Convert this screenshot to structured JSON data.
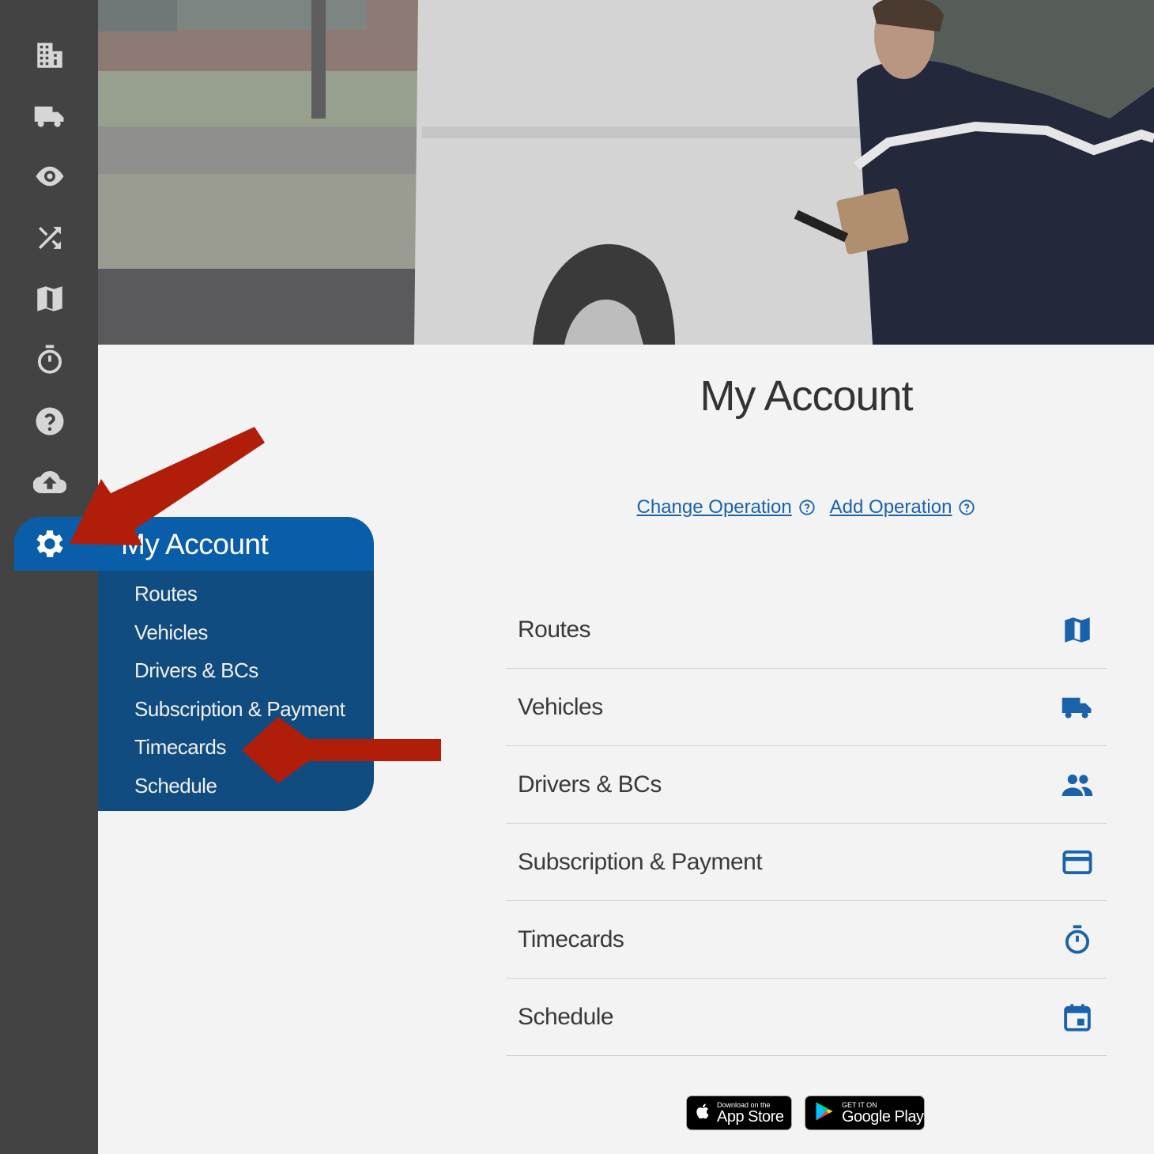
{
  "page": {
    "title": "My Account"
  },
  "operation_links": {
    "change": "Change Operation",
    "add": "Add Operation"
  },
  "flyout": {
    "title": "My Account",
    "items": [
      "Routes",
      "Vehicles",
      "Drivers & BCs",
      "Subscription & Payment",
      "Timecards",
      "Schedule"
    ]
  },
  "menu": [
    {
      "label": "Routes",
      "icon": "map-icon"
    },
    {
      "label": "Vehicles",
      "icon": "truck-icon"
    },
    {
      "label": "Drivers & BCs",
      "icon": "people-icon"
    },
    {
      "label": "Subscription & Payment",
      "icon": "credit-card-icon"
    },
    {
      "label": "Timecards",
      "icon": "stopwatch-icon"
    },
    {
      "label": "Schedule",
      "icon": "calendar-icon"
    }
  ],
  "sidebar_icons": [
    "building-icon",
    "truck-icon",
    "eye-icon",
    "shuffle-icon",
    "map-icon",
    "stopwatch-icon",
    "help-icon",
    "cloud-upload-icon",
    "gear-icon"
  ],
  "badges": {
    "apple_small": "Download on the",
    "apple_big": "App Store",
    "google_small": "GET IT ON",
    "google_big": "Google Play"
  },
  "colors": {
    "rail": "#434343",
    "accent": "#0a5ea9",
    "flyout": "#104c80",
    "link": "#1a62aa",
    "annotation_arrow": "#b01e0a"
  }
}
